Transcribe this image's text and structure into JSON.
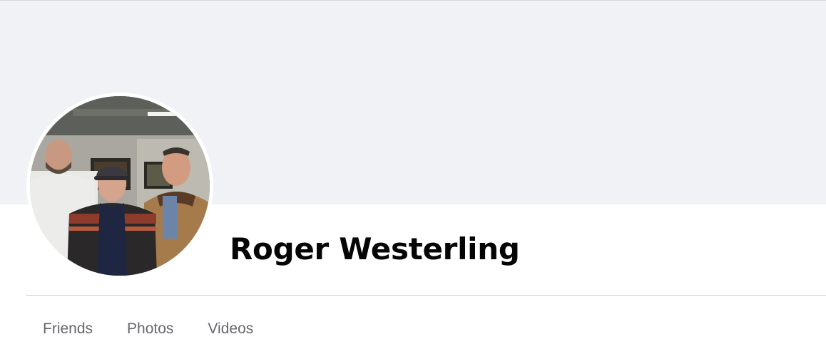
{
  "profile": {
    "name": "Roger Westerling",
    "avatar_icon": "profile-photo-three-men"
  },
  "tabs": [
    {
      "label": "Friends"
    },
    {
      "label": "Photos"
    },
    {
      "label": "Videos"
    }
  ],
  "colors": {
    "cover_background": "#f0f2f5",
    "name_text": "#050505",
    "tab_text": "#65676b",
    "divider": "#ced0d4"
  }
}
